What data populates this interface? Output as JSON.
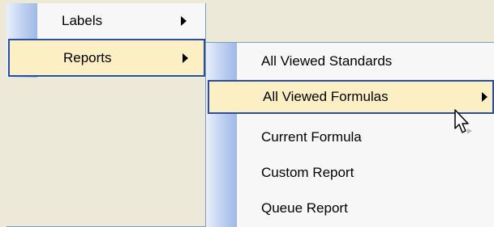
{
  "main_menu": {
    "items": [
      {
        "label": "Labels",
        "has_submenu": true,
        "highlighted": false
      },
      {
        "label": "Reports",
        "has_submenu": true,
        "highlighted": true
      }
    ]
  },
  "reports_submenu": {
    "items": [
      {
        "label": "All Viewed Standards",
        "has_submenu": false,
        "highlighted": false
      },
      {
        "label": "All Viewed Formulas",
        "has_submenu": true,
        "highlighted": true
      },
      {
        "label": "Current Formula",
        "has_submenu": false,
        "highlighted": false
      },
      {
        "label": "Custom Report",
        "has_submenu": false,
        "highlighted": false
      },
      {
        "label": "Queue Report",
        "has_submenu": false,
        "highlighted": false
      }
    ]
  },
  "colors": {
    "highlight_fill": "#fcefc4",
    "highlight_border": "#2b4da6",
    "menu_bg": "#f7f7f7",
    "desktop_bg": "#ece9d8"
  },
  "icons": {
    "submenu_arrow": "triangle-right",
    "cursor": "mouse-pointer"
  }
}
